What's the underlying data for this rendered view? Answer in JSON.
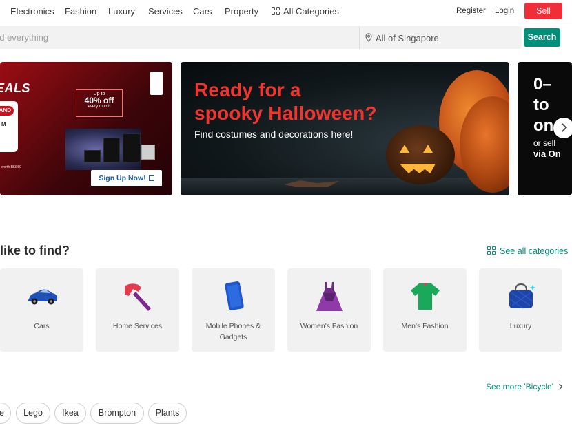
{
  "nav": {
    "links": [
      "Electronics",
      "Fashion",
      "Luxury",
      "Services",
      "Cars",
      "Property"
    ],
    "all_categories": "All Categories",
    "register": "Register",
    "login": "Login",
    "sell": "Sell"
  },
  "search": {
    "placeholder": "nd everything",
    "location": "All of Singapore",
    "button": "Search"
  },
  "banners": {
    "b1": {
      "headline": "EALS",
      "pill": "AND",
      "offer_upto": "Up to",
      "offer_pct": "40% off",
      "offer_period": "every month",
      "small1": "M",
      "small2": "worth $53.50",
      "cta": "Sign Up Now!"
    },
    "b2": {
      "title_line1": "Ready for a",
      "title_line2": "spooky Halloween?",
      "subtitle": "Find costumes and decorations here!"
    },
    "b3": {
      "line1": "0–",
      "line2": "to",
      "line3": "on",
      "small1": "or sell",
      "small2": "via On"
    },
    "colors": {
      "halloween_title": "#f0352f",
      "brand_red": "#f02e39",
      "brand_green": "#008f79"
    }
  },
  "categories": {
    "title": "like to find?",
    "see_all": "See all categories",
    "items": [
      {
        "label": "Cars",
        "icon": "car-icon"
      },
      {
        "label": "Home Services",
        "icon": "hammer-icon"
      },
      {
        "label": "Mobile Phones & Gadgets",
        "icon": "mobile-phone-icon"
      },
      {
        "label": "Women's Fashion",
        "icon": "dress-icon"
      },
      {
        "label": "Men's Fashion",
        "icon": "tshirt-icon"
      },
      {
        "label": "Luxury",
        "icon": "handbag-icon"
      }
    ]
  },
  "suggestions": {
    "see_more": "See more 'Bicycle'",
    "chips": [
      "e",
      "Lego",
      "Ikea",
      "Brompton",
      "Plants"
    ]
  }
}
